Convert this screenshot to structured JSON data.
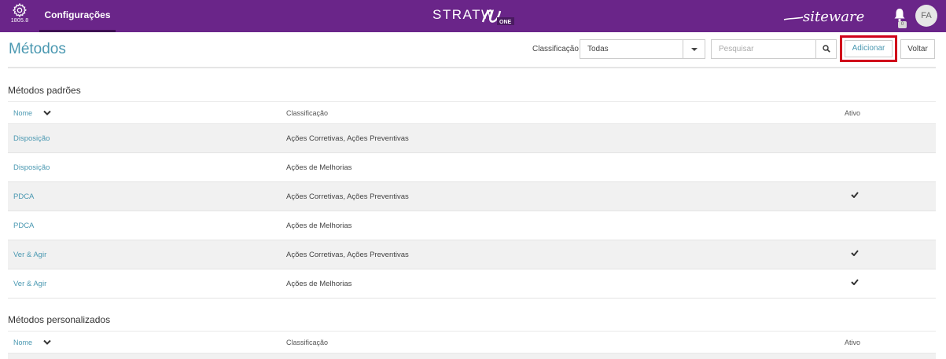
{
  "topbar": {
    "version": "1805.8",
    "nav_tab": "Configurações",
    "logo_center_text": "STRATW",
    "logo_center_badge": "ONE",
    "logo_right_text": "siteware",
    "avatar_initials": "FA",
    "notification_count": "0",
    "colors": {
      "bar": "#6a2589",
      "tab_underline": "#3d0f52"
    }
  },
  "header": {
    "title": "Métodos",
    "classification_label": "Classificação",
    "classification_value": "Todas",
    "search_placeholder": "Pesquisar",
    "add_label": "Adicionar",
    "back_label": "Voltar"
  },
  "sections": [
    {
      "title": "Métodos padrões",
      "columns": {
        "name": "Nome",
        "classification": "Classificação",
        "active": "Ativo"
      },
      "rows": [
        {
          "name": "Disposição",
          "classification": "Ações Corretivas, Ações Preventivas",
          "active": false
        },
        {
          "name": "Disposição",
          "classification": "Ações de Melhorias",
          "active": false
        },
        {
          "name": "PDCA",
          "classification": "Ações Corretivas, Ações Preventivas",
          "active": true
        },
        {
          "name": "PDCA",
          "classification": "Ações de Melhorias",
          "active": false
        },
        {
          "name": "Ver & Agir",
          "classification": "Ações Corretivas, Ações Preventivas",
          "active": true
        },
        {
          "name": "Ver & Agir",
          "classification": "Ações de Melhorias",
          "active": true
        }
      ]
    },
    {
      "title": "Métodos personalizados",
      "columns": {
        "name": "Nome",
        "classification": "Classificação",
        "active": "Ativo"
      },
      "rows": []
    }
  ],
  "colors": {
    "accent": "#4a98b1",
    "highlight": "#d0021b",
    "row_alt": "#f1f1f1"
  }
}
